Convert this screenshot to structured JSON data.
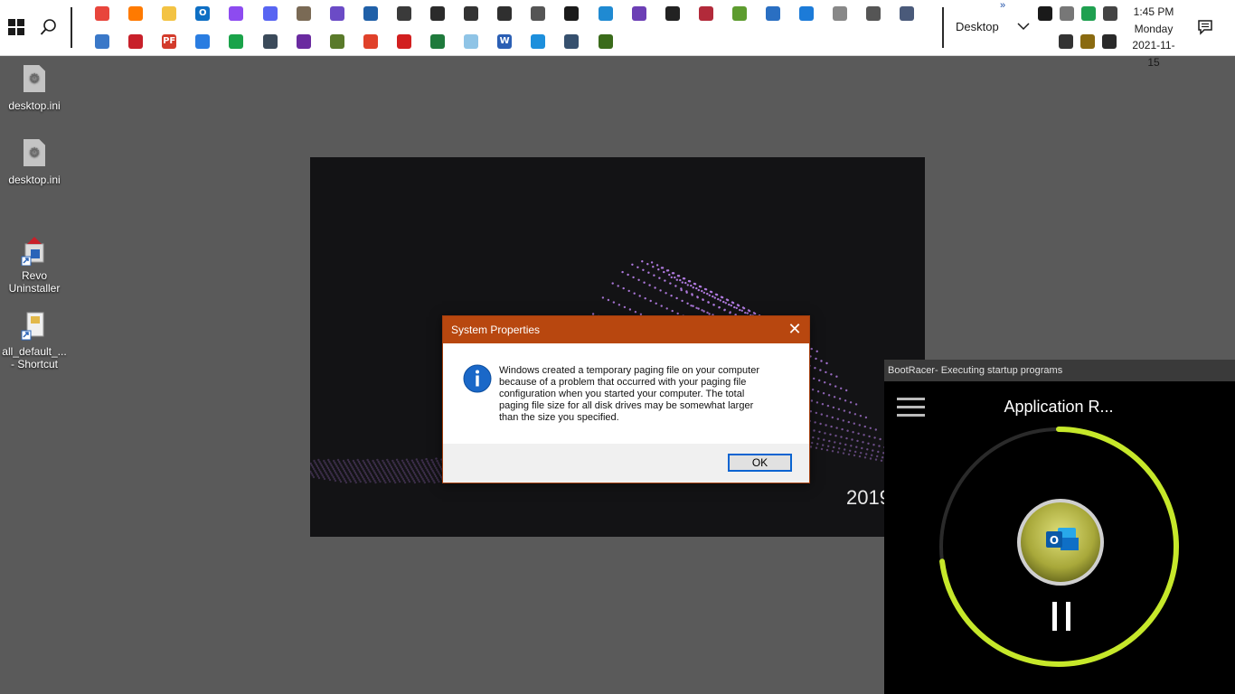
{
  "taskbar": {
    "pinned_row1": [
      {
        "name": "chrome-icon",
        "bg": "#e8453c",
        "glyph": ""
      },
      {
        "name": "firefox-icon",
        "bg": "#ff7a00",
        "glyph": ""
      },
      {
        "name": "file-explorer-icon",
        "bg": "#f3c343",
        "glyph": ""
      },
      {
        "name": "outlook-icon",
        "bg": "#0e6fc4",
        "glyph": "O"
      },
      {
        "name": "messenger-icon",
        "bg": "#8d4bf0",
        "glyph": ""
      },
      {
        "name": "discord-icon",
        "bg": "#5865f2",
        "glyph": ""
      },
      {
        "name": "gimp-icon",
        "bg": "#7a6a55",
        "glyph": ""
      },
      {
        "name": "paint-3d-icon",
        "bg": "#6b4bc6",
        "glyph": ""
      },
      {
        "name": "photos-app-icon",
        "bg": "#2060a8",
        "glyph": ""
      },
      {
        "name": "printer-icon",
        "bg": "#3a3a3a",
        "glyph": ""
      },
      {
        "name": "scanner-icon",
        "bg": "#2b2b2b",
        "glyph": ""
      },
      {
        "name": "camera-icon",
        "bg": "#333333",
        "glyph": ""
      },
      {
        "name": "notepad-plus-icon",
        "bg": "#2f2f2f",
        "glyph": ""
      },
      {
        "name": "clock-app-icon",
        "bg": "#555555",
        "glyph": ""
      },
      {
        "name": "command-prompt-icon",
        "bg": "#1a1a1a",
        "glyph": ""
      },
      {
        "name": "vscode-icon",
        "bg": "#1f8ad2",
        "glyph": ""
      },
      {
        "name": "visual-studio-icon",
        "bg": "#6c3fb5",
        "glyph": ""
      },
      {
        "name": "console-icon",
        "bg": "#222222",
        "glyph": ""
      },
      {
        "name": "flag-tool-icon",
        "bg": "#b22a3a",
        "glyph": ""
      },
      {
        "name": "windows-tool-icon",
        "bg": "#5d9c2f",
        "glyph": ""
      },
      {
        "name": "powershell-icon",
        "bg": "#2a6fc2",
        "glyph": ""
      },
      {
        "name": "network-tool-icon",
        "bg": "#1c7bd8",
        "glyph": ""
      },
      {
        "name": "security-tool-icon",
        "bg": "#888888",
        "glyph": ""
      },
      {
        "name": "settings-gear-icon",
        "bg": "#555555",
        "glyph": ""
      },
      {
        "name": "device-manager-icon",
        "bg": "#4a5a7a",
        "glyph": ""
      }
    ],
    "pinned_row2": [
      {
        "name": "control-panel-icon",
        "bg": "#3a78c8",
        "glyph": ""
      },
      {
        "name": "acrobat-tool-icon",
        "bg": "#c8202a",
        "glyph": ""
      },
      {
        "name": "pdf-tool-icon",
        "bg": "#d33b2b",
        "glyph": "PF"
      },
      {
        "name": "todo-icon",
        "bg": "#2a7de1",
        "glyph": ""
      },
      {
        "name": "green-app-icon",
        "bg": "#1aa34a",
        "glyph": ""
      },
      {
        "name": "remote-desktop-icon",
        "bg": "#3b4a5a",
        "glyph": ""
      },
      {
        "name": "media-app-icon",
        "bg": "#6a2ba0",
        "glyph": ""
      },
      {
        "name": "plant-app-icon",
        "bg": "#5a7a2a",
        "glyph": ""
      },
      {
        "name": "office-icon",
        "bg": "#e0412a",
        "glyph": ""
      },
      {
        "name": "acrobat-reader-icon",
        "bg": "#d21f1f",
        "glyph": ""
      },
      {
        "name": "excel-icon",
        "bg": "#1f7a3c",
        "glyph": ""
      },
      {
        "name": "notepad-icon",
        "bg": "#8fc4e6",
        "glyph": ""
      },
      {
        "name": "word-icon",
        "bg": "#2b5fb4",
        "glyph": "W"
      },
      {
        "name": "sync-app-icon",
        "bg": "#1d8fdc",
        "glyph": ""
      },
      {
        "name": "image-viewer-icon",
        "bg": "#36506e",
        "glyph": ""
      },
      {
        "name": "calculator-app-icon",
        "bg": "#3a6b1a",
        "glyph": ""
      }
    ],
    "toolbar_label": "Desktop",
    "overflow": "»",
    "tray_row1": [
      {
        "name": "tray-app-icon",
        "bg": "#1a1a1a"
      },
      {
        "name": "tray-device-icon",
        "bg": "#777777"
      },
      {
        "name": "tray-green-icon",
        "bg": "#1fa050"
      },
      {
        "name": "network-icon",
        "bg": "#444444"
      }
    ],
    "tray_row2": [
      {
        "name": "volume-icon",
        "bg": "#333333"
      },
      {
        "name": "tray-clipboard-icon",
        "bg": "#8a6a10"
      },
      {
        "name": "tray-camera-icon",
        "bg": "#2a2a2a"
      }
    ],
    "clock": {
      "time": "1:45 PM",
      "day": "Monday",
      "date": "2021-11-15"
    }
  },
  "desktop_icons": [
    {
      "label": "desktop.ini"
    },
    {
      "label": "desktop.ini"
    },
    {
      "label": "Revo\nUninstaller"
    },
    {
      "label": "all_default_...\n- Shortcut"
    }
  ],
  "splash": {
    "year_text": "2019"
  },
  "dialog": {
    "title": "System Properties",
    "close_glyph": "✕",
    "message": "Windows created a temporary paging file on your computer\nbecause of a problem that occurred with your paging file\nconfiguration when you started your computer.  The total\npaging file size for all disk drives may be somewhat larger\nthan the size you specified.",
    "ok_label": "OK"
  },
  "bootracer": {
    "title": "BootRacer- Executing startup programs",
    "app_label": "Application R...",
    "progress_fraction": 0.73,
    "accent": "#c6e82a"
  }
}
